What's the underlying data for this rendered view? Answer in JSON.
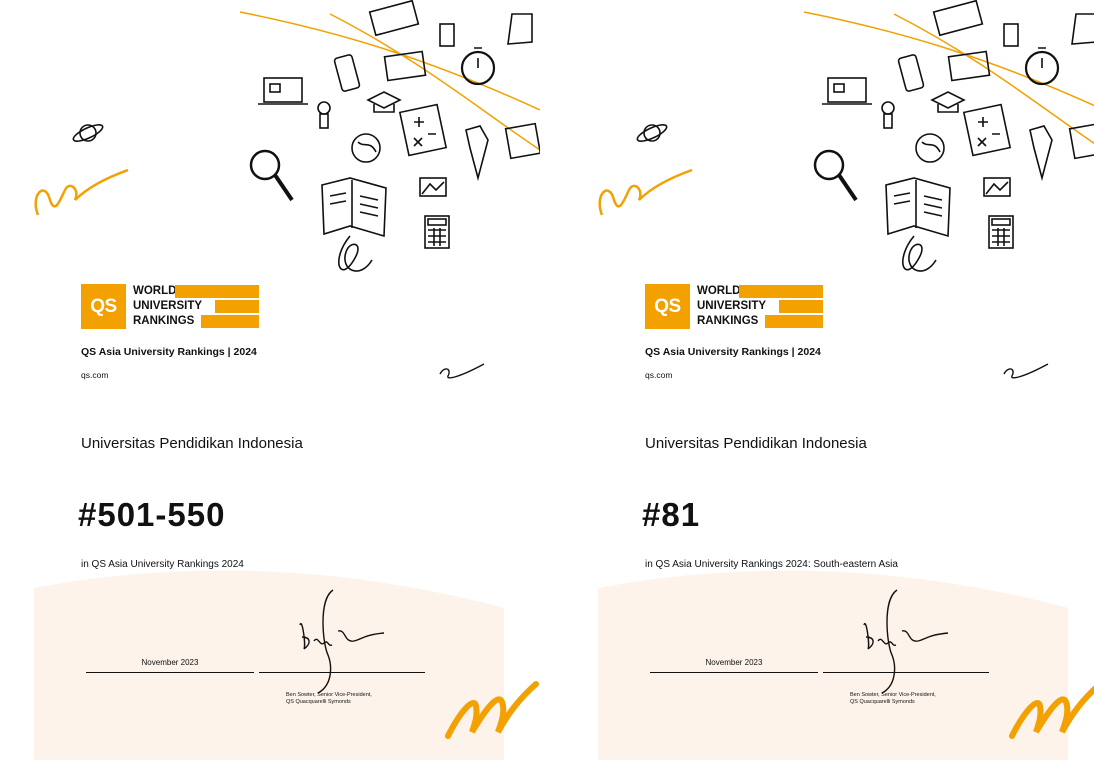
{
  "certificates": [
    {
      "logo": {
        "badge": "QS",
        "line1": "WORLD",
        "line2": "UNIVERSITY",
        "line3": "RANKINGS"
      },
      "ranking_title": "QS Asia University Rankings | 2024",
      "website": "qs.com",
      "university": "Universitas Pendidikan Indonesia",
      "rank": "#501-550",
      "context": "in QS Asia University Rankings 2024",
      "date": "November 2023",
      "signer_line1": "Ben Sowter, Senior Vice-President,",
      "signer_line2": "QS Quacquarelli Symonds"
    },
    {
      "logo": {
        "badge": "QS",
        "line1": "WORLD",
        "line2": "UNIVERSITY",
        "line3": "RANKINGS"
      },
      "ranking_title": "QS Asia University Rankings | 2024",
      "website": "qs.com",
      "university": "Universitas Pendidikan Indonesia",
      "rank": "#81",
      "context": "in QS Asia University Rankings 2024: South-eastern Asia",
      "date": "November 2023",
      "signer_line1": "Ben Sowter, Senior Vice-President,",
      "signer_line2": "QS Quacquarelli Symonds"
    }
  ],
  "colors": {
    "accent": "#f2a100",
    "peach": "#fdf3ea"
  },
  "icons": [
    "planet-icon",
    "magnifier-icon",
    "laptop-icon",
    "phone-icon",
    "lightbulb-icon",
    "graduation-cap-icon",
    "globe-icon",
    "math-sheet-icon",
    "stopwatch-icon",
    "open-book-icon",
    "picture-icon",
    "calculator-icon",
    "necktie-icon"
  ]
}
